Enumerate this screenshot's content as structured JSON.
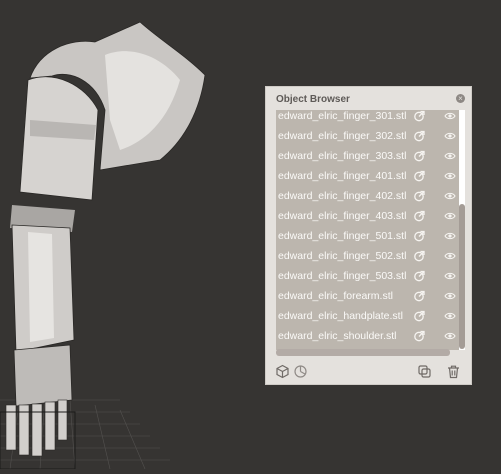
{
  "panel": {
    "title": "Object Browser",
    "close_icon": "close-icon"
  },
  "objects": [
    {
      "name": "edward_elric_finger_301.stl"
    },
    {
      "name": "edward_elric_finger_302.stl"
    },
    {
      "name": "edward_elric_finger_303.stl"
    },
    {
      "name": "edward_elric_finger_401.stl"
    },
    {
      "name": "edward_elric_finger_402.stl"
    },
    {
      "name": "edward_elric_finger_403.stl"
    },
    {
      "name": "edward_elric_finger_501.stl"
    },
    {
      "name": "edward_elric_finger_502.stl"
    },
    {
      "name": "edward_elric_finger_503.stl"
    },
    {
      "name": "edward_elric_forearm.stl"
    },
    {
      "name": "edward_elric_handplate.stl"
    },
    {
      "name": "edward_elric_shoulder.stl"
    }
  ],
  "row_icons": {
    "link": "link-icon",
    "visibility": "eye-icon"
  },
  "footer": {
    "icons": [
      "cube-icon",
      "pie-chart-icon",
      "duplicate-icon",
      "trash-icon"
    ]
  },
  "colors": {
    "viewport_bg": "#363432",
    "panel_bg": "#e4e1dd",
    "list_bg": "#bcb6ae",
    "text_light": "#fbfaf8",
    "title_text": "#5e5a57"
  }
}
